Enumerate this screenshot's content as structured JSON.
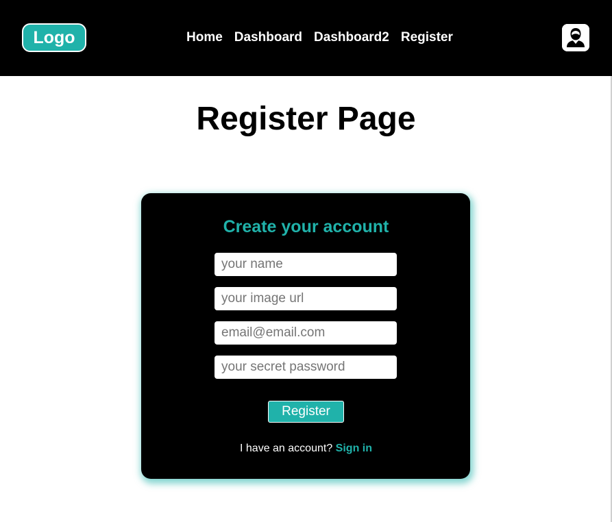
{
  "navbar": {
    "logo_label": "Logo",
    "links": [
      {
        "label": "Home"
      },
      {
        "label": "Dashboard"
      },
      {
        "label": "Dashboard2"
      },
      {
        "label": "Register"
      }
    ],
    "avatar_icon": "user-avatar-icon"
  },
  "page": {
    "title": "Register Page"
  },
  "form": {
    "title": "Create your account",
    "name_field": {
      "placeholder": "your name",
      "value": ""
    },
    "image_field": {
      "placeholder": "your image url",
      "value": ""
    },
    "email_field": {
      "placeholder": "email@email.com",
      "value": ""
    },
    "password_field": {
      "placeholder": "your secret password",
      "value": ""
    },
    "submit_label": "Register",
    "account_prompt": "I have an account?",
    "signin_label": "Sign in"
  },
  "colors": {
    "accent": "#20b2aa",
    "navbar_bg": "#000000",
    "card_bg": "#000000",
    "page_bg": "#ffffff"
  }
}
